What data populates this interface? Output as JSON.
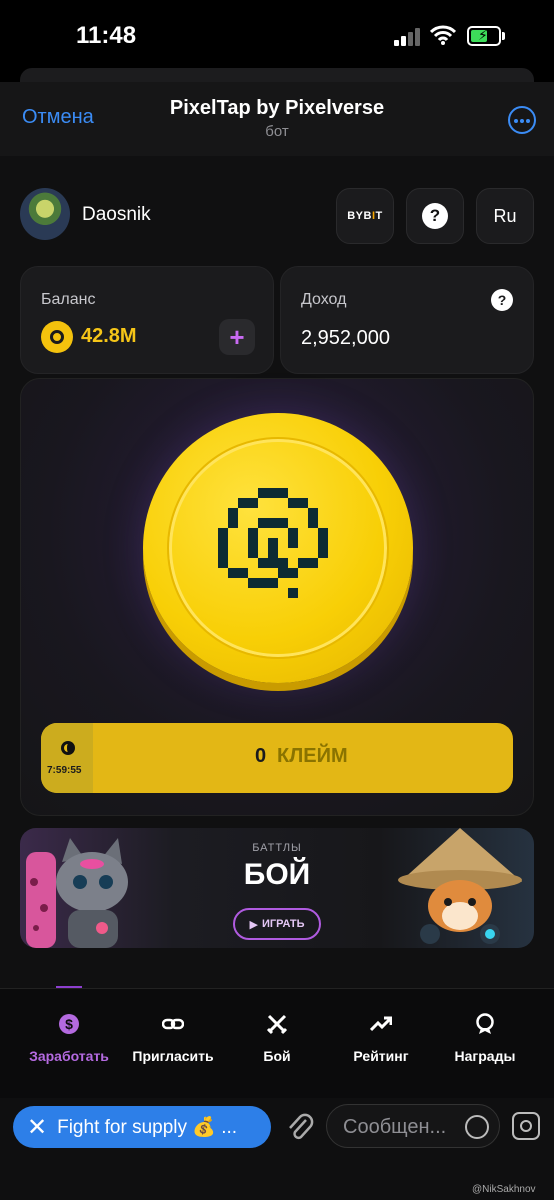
{
  "status_bar": {
    "time": "11:48"
  },
  "header": {
    "cancel_label": "Отмена",
    "title": "PixelTap by Pixelverse",
    "subtitle": "бот"
  },
  "profile": {
    "username": "Daosnik"
  },
  "top_buttons": {
    "bybit_a": "BYB",
    "bybit_b": "I",
    "bybit_c": "T",
    "help": "?",
    "language": "Ru"
  },
  "balance": {
    "label": "Баланс",
    "value": "42.8M",
    "add": "+"
  },
  "income": {
    "label": "Доход",
    "value": "2,952,000",
    "help": "?"
  },
  "claim": {
    "timer": "7:59:55",
    "amount": "0",
    "label": "КЛЕЙМ"
  },
  "battle": {
    "subtitle": "БАТТЛЫ",
    "title": "БОЙ",
    "play_label": "ИГРАТЬ"
  },
  "tabs": [
    {
      "label": "Заработать",
      "icon": "dollar-icon"
    },
    {
      "label": "Пригласить",
      "icon": "link-icon"
    },
    {
      "label": "Бой",
      "icon": "swords-icon"
    },
    {
      "label": "Рейтинг",
      "icon": "trending-up-icon"
    },
    {
      "label": "Награды",
      "icon": "award-icon"
    }
  ],
  "chat": {
    "menu_button": "Fight for supply 💰 ...",
    "message_placeholder": "Сообщен..."
  },
  "watermark": "@NikSakhnov",
  "colors": {
    "accent_blue": "#3b8cf5",
    "coin_yellow": "#f8cf06",
    "purple": "#b46ae0"
  }
}
